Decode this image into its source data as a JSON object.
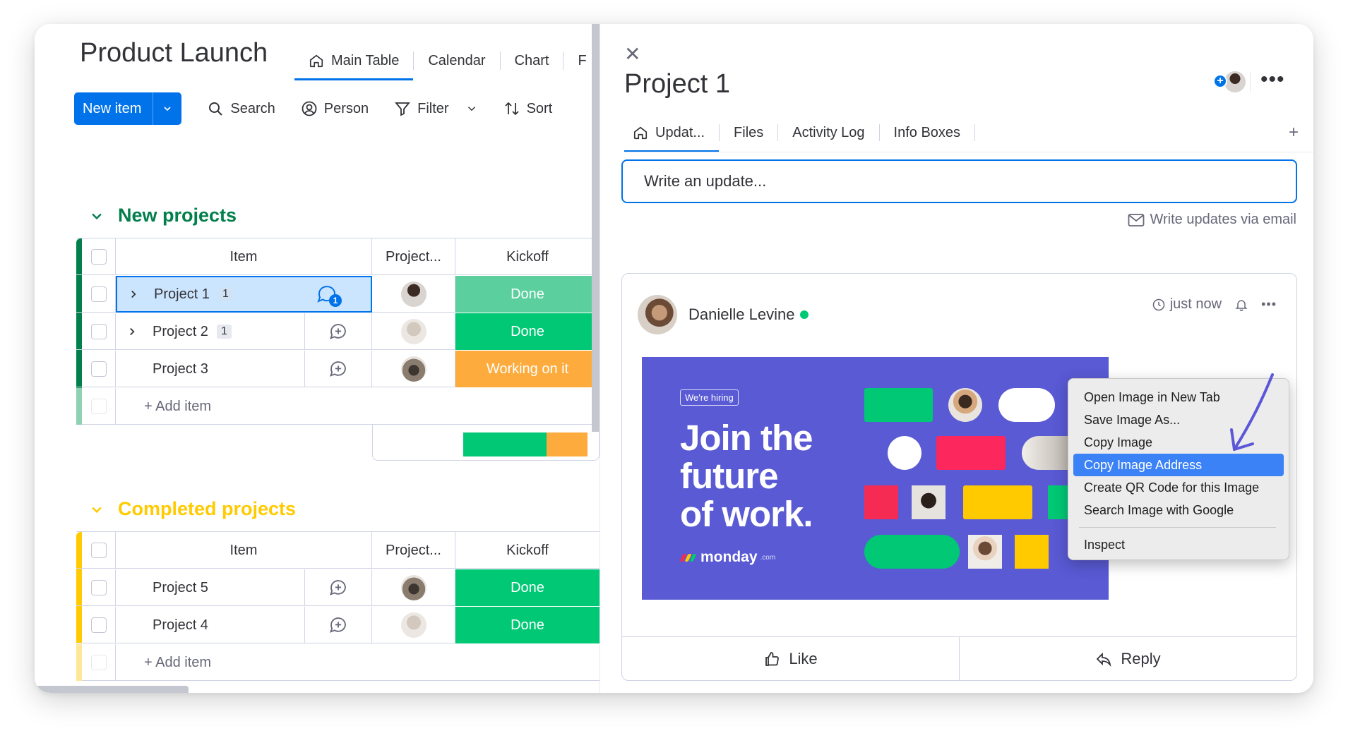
{
  "board": {
    "title": "Product Launch",
    "views": [
      "Main Table",
      "Calendar",
      "Chart",
      "F"
    ],
    "toolbar": {
      "new_item": "New item",
      "search": "Search",
      "person": "Person",
      "filter": "Filter",
      "sort": "Sort"
    },
    "groups": [
      {
        "title": "New projects",
        "color": "#037f4c",
        "header": {
          "item": "Item",
          "project": "Project...",
          "kickoff": "Kickoff"
        },
        "rows": [
          {
            "name": "Project 1",
            "count": "1",
            "status": "Done",
            "status_color": "#5ccf9f"
          },
          {
            "name": "Project 2",
            "count": "1",
            "status": "Done",
            "status_color": "#00c875"
          },
          {
            "name": "Project 3",
            "count": "",
            "status": "Working on it",
            "status_color": "#fdab3d"
          }
        ],
        "add_item": "+ Add item"
      },
      {
        "title": "Completed projects",
        "color": "#ffcb00",
        "header": {
          "item": "Item",
          "project": "Project...",
          "kickoff": "Kickoff"
        },
        "rows": [
          {
            "name": "Project 5",
            "status": "Done",
            "status_color": "#00c875"
          },
          {
            "name": "Project 4",
            "status": "Done",
            "status_color": "#00c875"
          }
        ],
        "add_item": "+ Add item"
      }
    ],
    "status_summary": {
      "done_fraction": 0.67,
      "working_fraction": 0.33
    }
  },
  "panel": {
    "title": "Project 1",
    "tabs": [
      "Updat...",
      "Files",
      "Activity Log",
      "Info Boxes"
    ],
    "add_tab": "+",
    "write_placeholder": "Write an update...",
    "email_link": "Write updates via email",
    "post": {
      "author": "Danielle Levine",
      "time": "just now",
      "image": {
        "badge": "We're hiring",
        "headline": [
          "Join the",
          "future",
          "of work."
        ],
        "logo": "monday",
        "logo_suffix": ".com"
      },
      "like": "Like",
      "reply": "Reply"
    }
  },
  "context_menu": {
    "items": [
      "Open Image in New Tab",
      "Save Image As...",
      "Copy Image",
      "Copy Image Address",
      "Create QR Code for this Image",
      "Search Image with Google"
    ],
    "highlighted": "Copy Image Address",
    "inspect": "Inspect"
  },
  "colors": {
    "accent": "#0073ea",
    "done": "#00c875",
    "working": "#fdab3d",
    "image_bg": "#595ad4"
  }
}
